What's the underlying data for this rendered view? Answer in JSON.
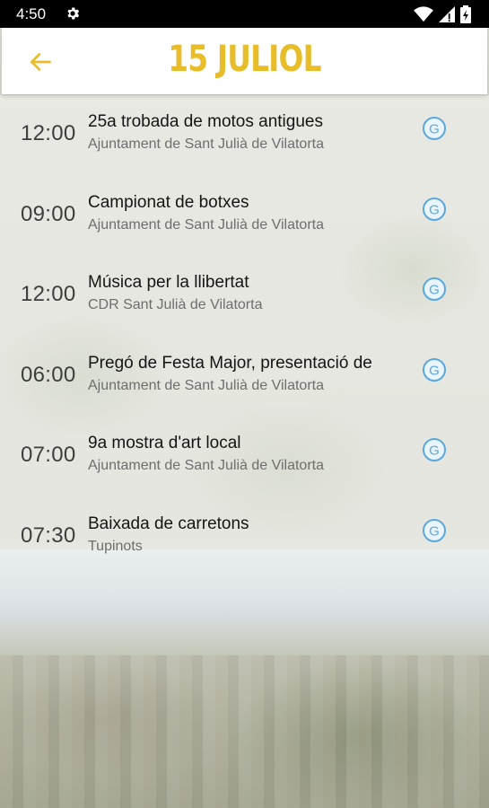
{
  "status_bar": {
    "time": "4:50",
    "icons": [
      "settings-icon",
      "wifi-icon",
      "signal-icon",
      "battery-icon"
    ]
  },
  "app_bar": {
    "back_icon": "arrow-left-icon",
    "title": "15 JULIOL",
    "accent_color": "#e8bd2a"
  },
  "events": [
    {
      "time": "12:00",
      "title": "25a trobada de motos antigues",
      "organizer": "Ajuntament de Sant Julià de Vilatorta",
      "icon": "g-circle-icon"
    },
    {
      "time": "09:00",
      "title": "Campionat de botxes",
      "organizer": "Ajuntament de Sant Julià de Vilatorta",
      "icon": "g-circle-icon"
    },
    {
      "time": "12:00",
      "title": "Música per la llibertat",
      "organizer": "CDR Sant Julià de Vilatorta",
      "icon": "g-circle-icon"
    },
    {
      "time": "06:00",
      "title": "Pregó de Festa Major, presentació de",
      "organizer": "Ajuntament de Sant Julià de Vilatorta",
      "icon": "g-circle-icon"
    },
    {
      "time": "07:00",
      "title": "9a mostra d'art local",
      "organizer": "Ajuntament de Sant Julià de Vilatorta",
      "icon": "g-circle-icon"
    },
    {
      "time": "07:30",
      "title": "Baixada de carretons",
      "organizer": "Tupinots",
      "icon": "g-circle-icon"
    }
  ]
}
